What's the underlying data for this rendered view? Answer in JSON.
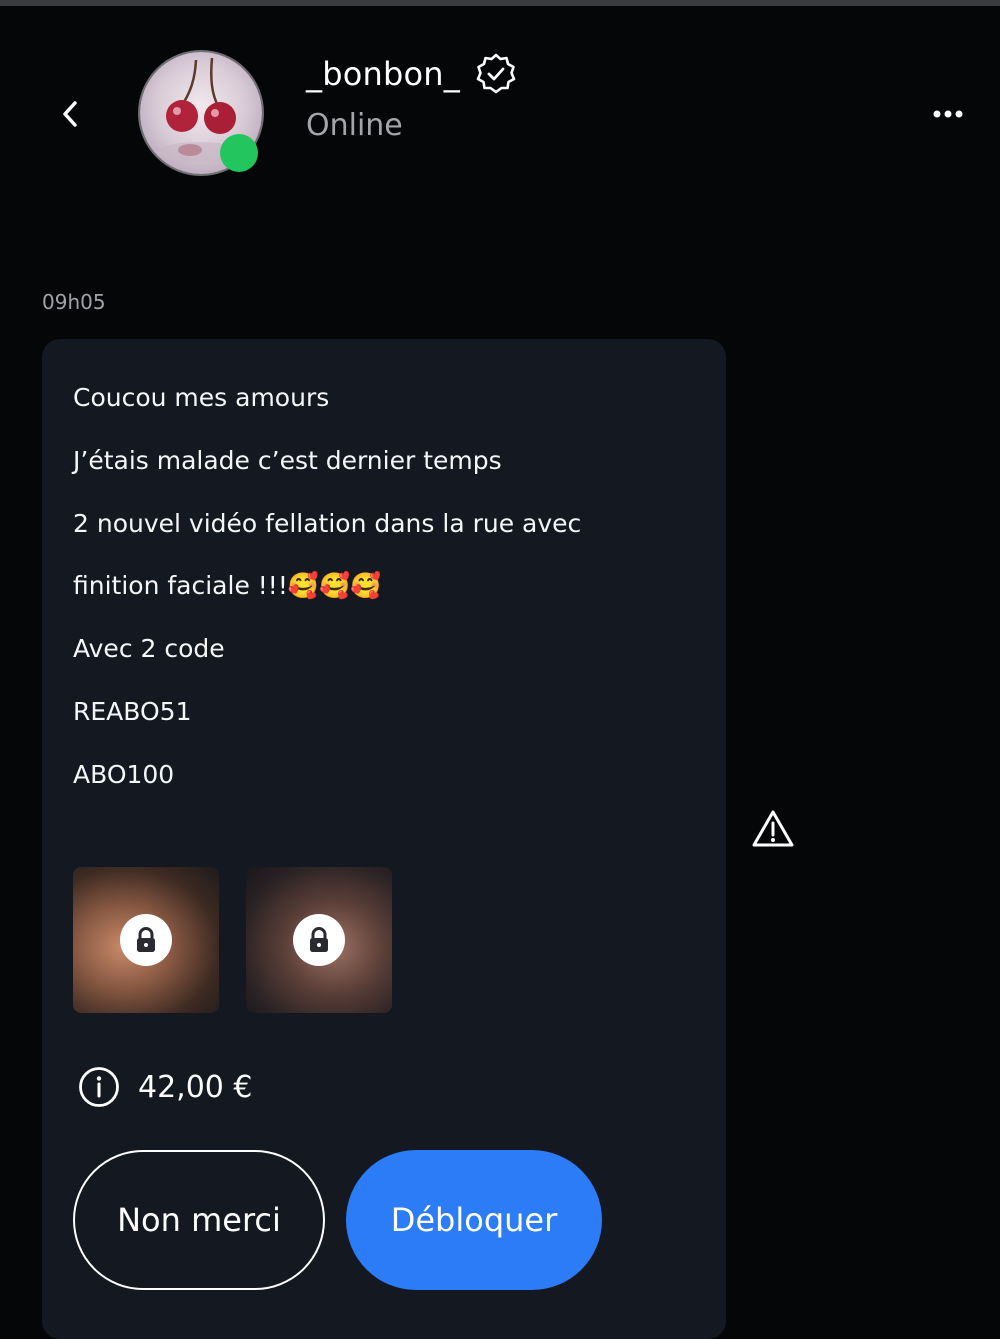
{
  "header": {
    "username": "_bonbon_",
    "status": "Online",
    "icons": {
      "back": "chevron-left-icon",
      "verified": "verified-badge-icon",
      "more": "more-dots-icon"
    },
    "online_color": "#22c55e"
  },
  "message": {
    "timestamp": "09h05",
    "lines": [
      "Coucou mes amours",
      "J’étais malade c’est dernier temps",
      "2 nouvel vidéo fellation dans la rue avec",
      "finition faciale !!!🥰🥰🥰",
      "Avec 2 code",
      "REABO51",
      "ABO100"
    ],
    "media": [
      {
        "icon": "lock-icon",
        "locked": true
      },
      {
        "icon": "lock-icon",
        "locked": true
      }
    ],
    "price": "42,00 €",
    "info_icon": "info-icon",
    "report_icon": "warning-triangle-icon"
  },
  "actions": {
    "decline_label": "Non merci",
    "unlock_label": "Débloquer"
  },
  "colors": {
    "background": "#050608",
    "bubble": "#141821",
    "primary": "#2b7cf6"
  }
}
